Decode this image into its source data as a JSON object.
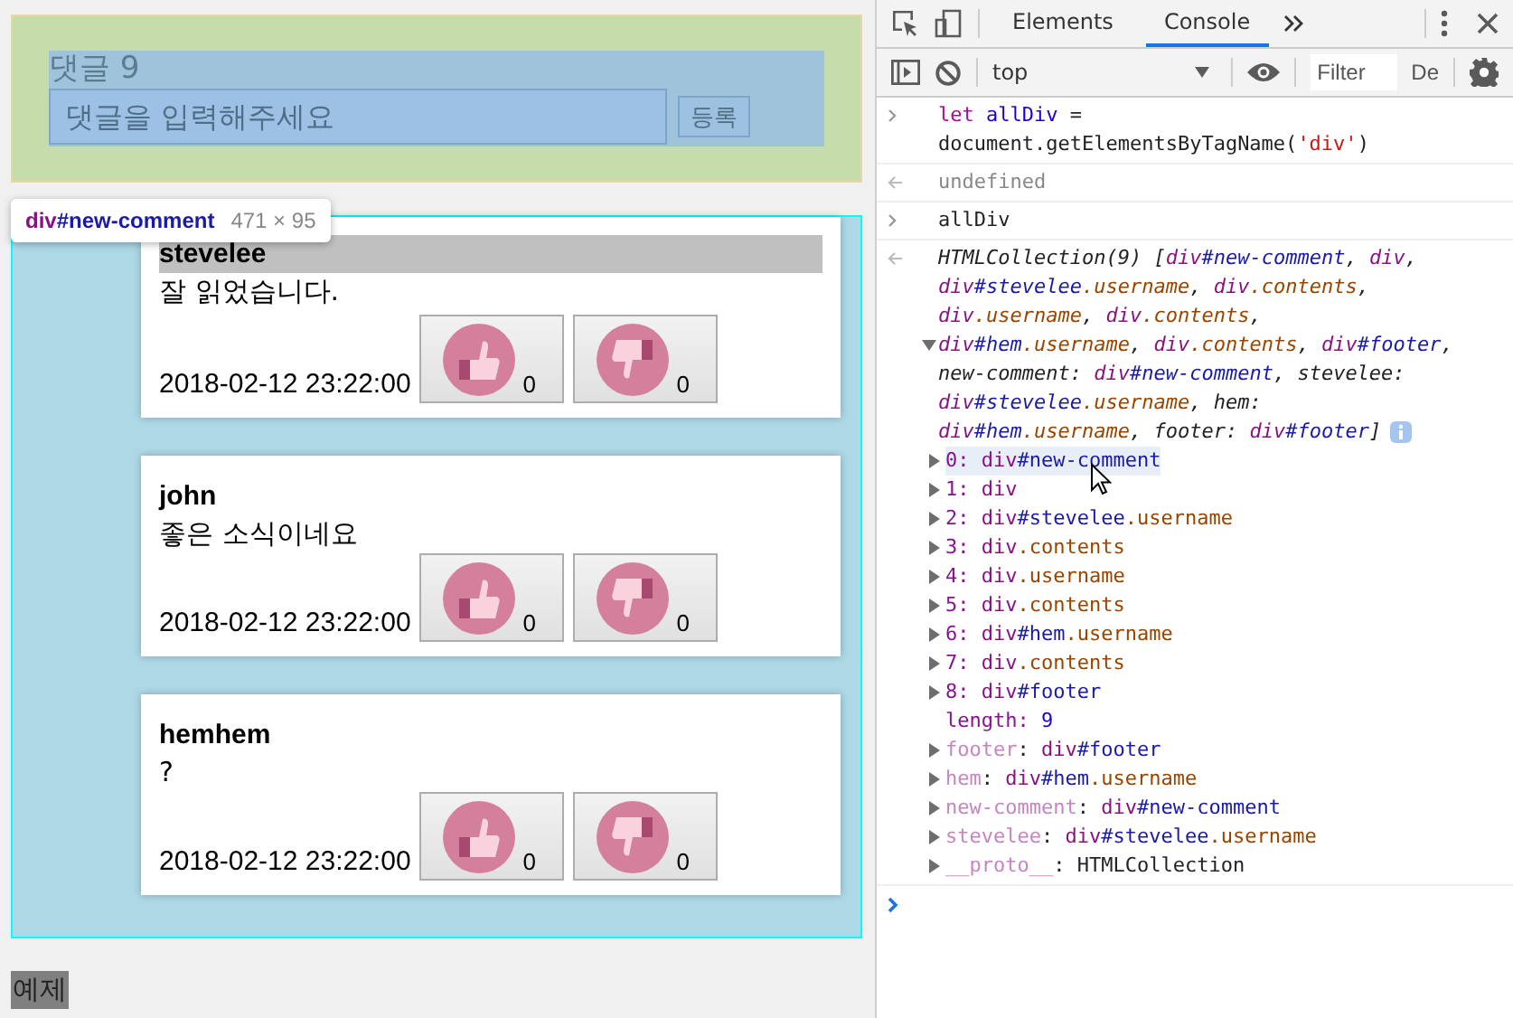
{
  "page": {
    "new_comment": {
      "label": "댓글 9",
      "placeholder": "댓글을 입력해주세요",
      "submit": "등록"
    },
    "inspect_tooltip": {
      "tag": "div",
      "id": "#new-comment",
      "size": "471 × 95"
    },
    "comments": [
      {
        "username": "stevelee",
        "highlighted": true,
        "text": "잘 읽었습니다.",
        "date": "2018-02-12 23:22:00",
        "likes": "0",
        "dislikes": "0"
      },
      {
        "username": "john",
        "highlighted": false,
        "text": "좋은 소식이네요",
        "date": "2018-02-12 23:22:00",
        "likes": "0",
        "dislikes": "0"
      },
      {
        "username": "hemhem",
        "highlighted": false,
        "text": "?",
        "date": "2018-02-12 23:22:00",
        "likes": "0",
        "dislikes": "0"
      }
    ],
    "footer": "예제"
  },
  "devtools": {
    "tabs": [
      {
        "label": "Elements",
        "selected": false
      },
      {
        "label": "Console",
        "selected": true
      }
    ],
    "context": "top",
    "filter_placeholder": "Filter",
    "levels": "De",
    "console": [
      {
        "kind": "input",
        "lines": [
          {
            "tokens": [
              {
                "text": "let ",
                "kind": "keyword"
              },
              {
                "text": "allDiv",
                "kind": "ident"
              },
              {
                "text": " =",
                "kind": "plain"
              }
            ]
          },
          {
            "tokens": [
              {
                "text": "document.getElementsByTagName(",
                "kind": "plain"
              },
              {
                "text": "'div'",
                "kind": "string"
              },
              {
                "text": ")",
                "kind": "plain"
              }
            ]
          }
        ]
      },
      {
        "kind": "return",
        "lines": [
          {
            "tokens": [
              {
                "text": "undefined",
                "kind": "dim"
              }
            ]
          }
        ]
      },
      {
        "kind": "input",
        "lines": [
          {
            "tokens": [
              {
                "text": "allDiv",
                "kind": "plain"
              }
            ]
          }
        ]
      },
      {
        "kind": "collection",
        "lines": [
          {
            "tokens": [
              {
                "text": "HTMLCollection(9) [",
                "kind": "plain"
              },
              {
                "text": "div",
                "kind": "tag"
              },
              {
                "text": "#new-comment",
                "kind": "id"
              },
              {
                "text": ", ",
                "kind": "plain"
              },
              {
                "text": "div",
                "kind": "tag"
              },
              {
                "text": ",",
                "kind": "plain"
              }
            ]
          },
          {
            "tokens": [
              {
                "text": "div",
                "kind": "tag"
              },
              {
                "text": "#stevelee",
                "kind": "id"
              },
              {
                "text": ".username",
                "kind": "class"
              },
              {
                "text": ", ",
                "kind": "plain"
              },
              {
                "text": "div",
                "kind": "tag"
              },
              {
                "text": ".contents",
                "kind": "class"
              },
              {
                "text": ",",
                "kind": "plain"
              }
            ]
          },
          {
            "tokens": [
              {
                "text": "div",
                "kind": "tag"
              },
              {
                "text": ".username",
                "kind": "class"
              },
              {
                "text": ", ",
                "kind": "plain"
              },
              {
                "text": "div",
                "kind": "tag"
              },
              {
                "text": ".contents",
                "kind": "class"
              },
              {
                "text": ",",
                "kind": "plain"
              }
            ]
          },
          {
            "expanded": true,
            "tokens": [
              {
                "text": "div",
                "kind": "tag"
              },
              {
                "text": "#hem",
                "kind": "id"
              },
              {
                "text": ".username",
                "kind": "class"
              },
              {
                "text": ", ",
                "kind": "plain"
              },
              {
                "text": "div",
                "kind": "tag"
              },
              {
                "text": ".contents",
                "kind": "class"
              },
              {
                "text": ", ",
                "kind": "plain"
              },
              {
                "text": "div",
                "kind": "tag"
              },
              {
                "text": "#footer",
                "kind": "id"
              },
              {
                "text": ",",
                "kind": "plain"
              }
            ]
          },
          {
            "tokens": [
              {
                "text": "new-comment: ",
                "kind": "plain"
              },
              {
                "text": "div",
                "kind": "tag"
              },
              {
                "text": "#new-comment",
                "kind": "id"
              },
              {
                "text": ", stevelee:",
                "kind": "plain"
              }
            ]
          },
          {
            "tokens": [
              {
                "text": "div",
                "kind": "tag"
              },
              {
                "text": "#stevelee",
                "kind": "id"
              },
              {
                "text": ".username",
                "kind": "class"
              },
              {
                "text": ", hem:",
                "kind": "plain"
              }
            ]
          },
          {
            "info": true,
            "tokens": [
              {
                "text": "div",
                "kind": "tag"
              },
              {
                "text": "#hem",
                "kind": "id"
              },
              {
                "text": ".username",
                "kind": "class"
              },
              {
                "text": ", footer: ",
                "kind": "plain"
              },
              {
                "text": "div",
                "kind": "tag"
              },
              {
                "text": "#footer",
                "kind": "id"
              },
              {
                "text": "]",
                "kind": "plain"
              }
            ]
          }
        ],
        "items": [
          {
            "toggle": true,
            "hovered": true,
            "tokens": [
              {
                "text": "0: ",
                "kind": "index"
              },
              {
                "text": "div",
                "kind": "tag"
              },
              {
                "text": "#new-comment",
                "kind": "id"
              }
            ]
          },
          {
            "toggle": true,
            "hovered": false,
            "tokens": [
              {
                "text": "1: ",
                "kind": "index"
              },
              {
                "text": "div",
                "kind": "tag"
              }
            ]
          },
          {
            "toggle": true,
            "hovered": false,
            "tokens": [
              {
                "text": "2: ",
                "kind": "index"
              },
              {
                "text": "div",
                "kind": "tag"
              },
              {
                "text": "#stevelee",
                "kind": "id"
              },
              {
                "text": ".username",
                "kind": "class"
              }
            ]
          },
          {
            "toggle": true,
            "hovered": false,
            "tokens": [
              {
                "text": "3: ",
                "kind": "index"
              },
              {
                "text": "div",
                "kind": "tag"
              },
              {
                "text": ".contents",
                "kind": "class"
              }
            ]
          },
          {
            "toggle": true,
            "hovered": false,
            "tokens": [
              {
                "text": "4: ",
                "kind": "index"
              },
              {
                "text": "div",
                "kind": "tag"
              },
              {
                "text": ".username",
                "kind": "class"
              }
            ]
          },
          {
            "toggle": true,
            "hovered": false,
            "tokens": [
              {
                "text": "5: ",
                "kind": "index"
              },
              {
                "text": "div",
                "kind": "tag"
              },
              {
                "text": ".contents",
                "kind": "class"
              }
            ]
          },
          {
            "toggle": true,
            "hovered": false,
            "tokens": [
              {
                "text": "6: ",
                "kind": "index"
              },
              {
                "text": "div",
                "kind": "tag"
              },
              {
                "text": "#hem",
                "kind": "id"
              },
              {
                "text": ".username",
                "kind": "class"
              }
            ]
          },
          {
            "toggle": true,
            "hovered": false,
            "tokens": [
              {
                "text": "7: ",
                "kind": "index"
              },
              {
                "text": "div",
                "kind": "tag"
              },
              {
                "text": ".contents",
                "kind": "class"
              }
            ]
          },
          {
            "toggle": true,
            "hovered": false,
            "tokens": [
              {
                "text": "8: ",
                "kind": "index"
              },
              {
                "text": "div",
                "kind": "tag"
              },
              {
                "text": "#footer",
                "kind": "id"
              }
            ]
          },
          {
            "toggle": false,
            "hovered": false,
            "tokens": [
              {
                "text": "length: ",
                "kind": "index"
              },
              {
                "text": "9",
                "kind": "number"
              }
            ]
          },
          {
            "toggle": true,
            "hovered": false,
            "tokens": [
              {
                "text": "footer",
                "kind": "dimkey"
              },
              {
                "text": ": ",
                "kind": "plain"
              },
              {
                "text": "div",
                "kind": "tag"
              },
              {
                "text": "#footer",
                "kind": "id"
              }
            ]
          },
          {
            "toggle": true,
            "hovered": false,
            "tokens": [
              {
                "text": "hem",
                "kind": "dimkey"
              },
              {
                "text": ": ",
                "kind": "plain"
              },
              {
                "text": "div",
                "kind": "tag"
              },
              {
                "text": "#hem",
                "kind": "id"
              },
              {
                "text": ".username",
                "kind": "class"
              }
            ]
          },
          {
            "toggle": true,
            "hovered": false,
            "tokens": [
              {
                "text": "new-comment",
                "kind": "dimkey"
              },
              {
                "text": ": ",
                "kind": "plain"
              },
              {
                "text": "div",
                "kind": "tag"
              },
              {
                "text": "#new-comment",
                "kind": "id"
              }
            ]
          },
          {
            "toggle": true,
            "hovered": false,
            "tokens": [
              {
                "text": "stevelee",
                "kind": "dimkey"
              },
              {
                "text": ": ",
                "kind": "plain"
              },
              {
                "text": "div",
                "kind": "tag"
              },
              {
                "text": "#stevelee",
                "kind": "id"
              },
              {
                "text": ".username",
                "kind": "class"
              }
            ]
          },
          {
            "toggle": true,
            "hovered": false,
            "tokens": [
              {
                "text": "__proto__",
                "kind": "dimkey"
              },
              {
                "text": ": HTMLCollection",
                "kind": "plain"
              }
            ]
          }
        ]
      }
    ]
  }
}
